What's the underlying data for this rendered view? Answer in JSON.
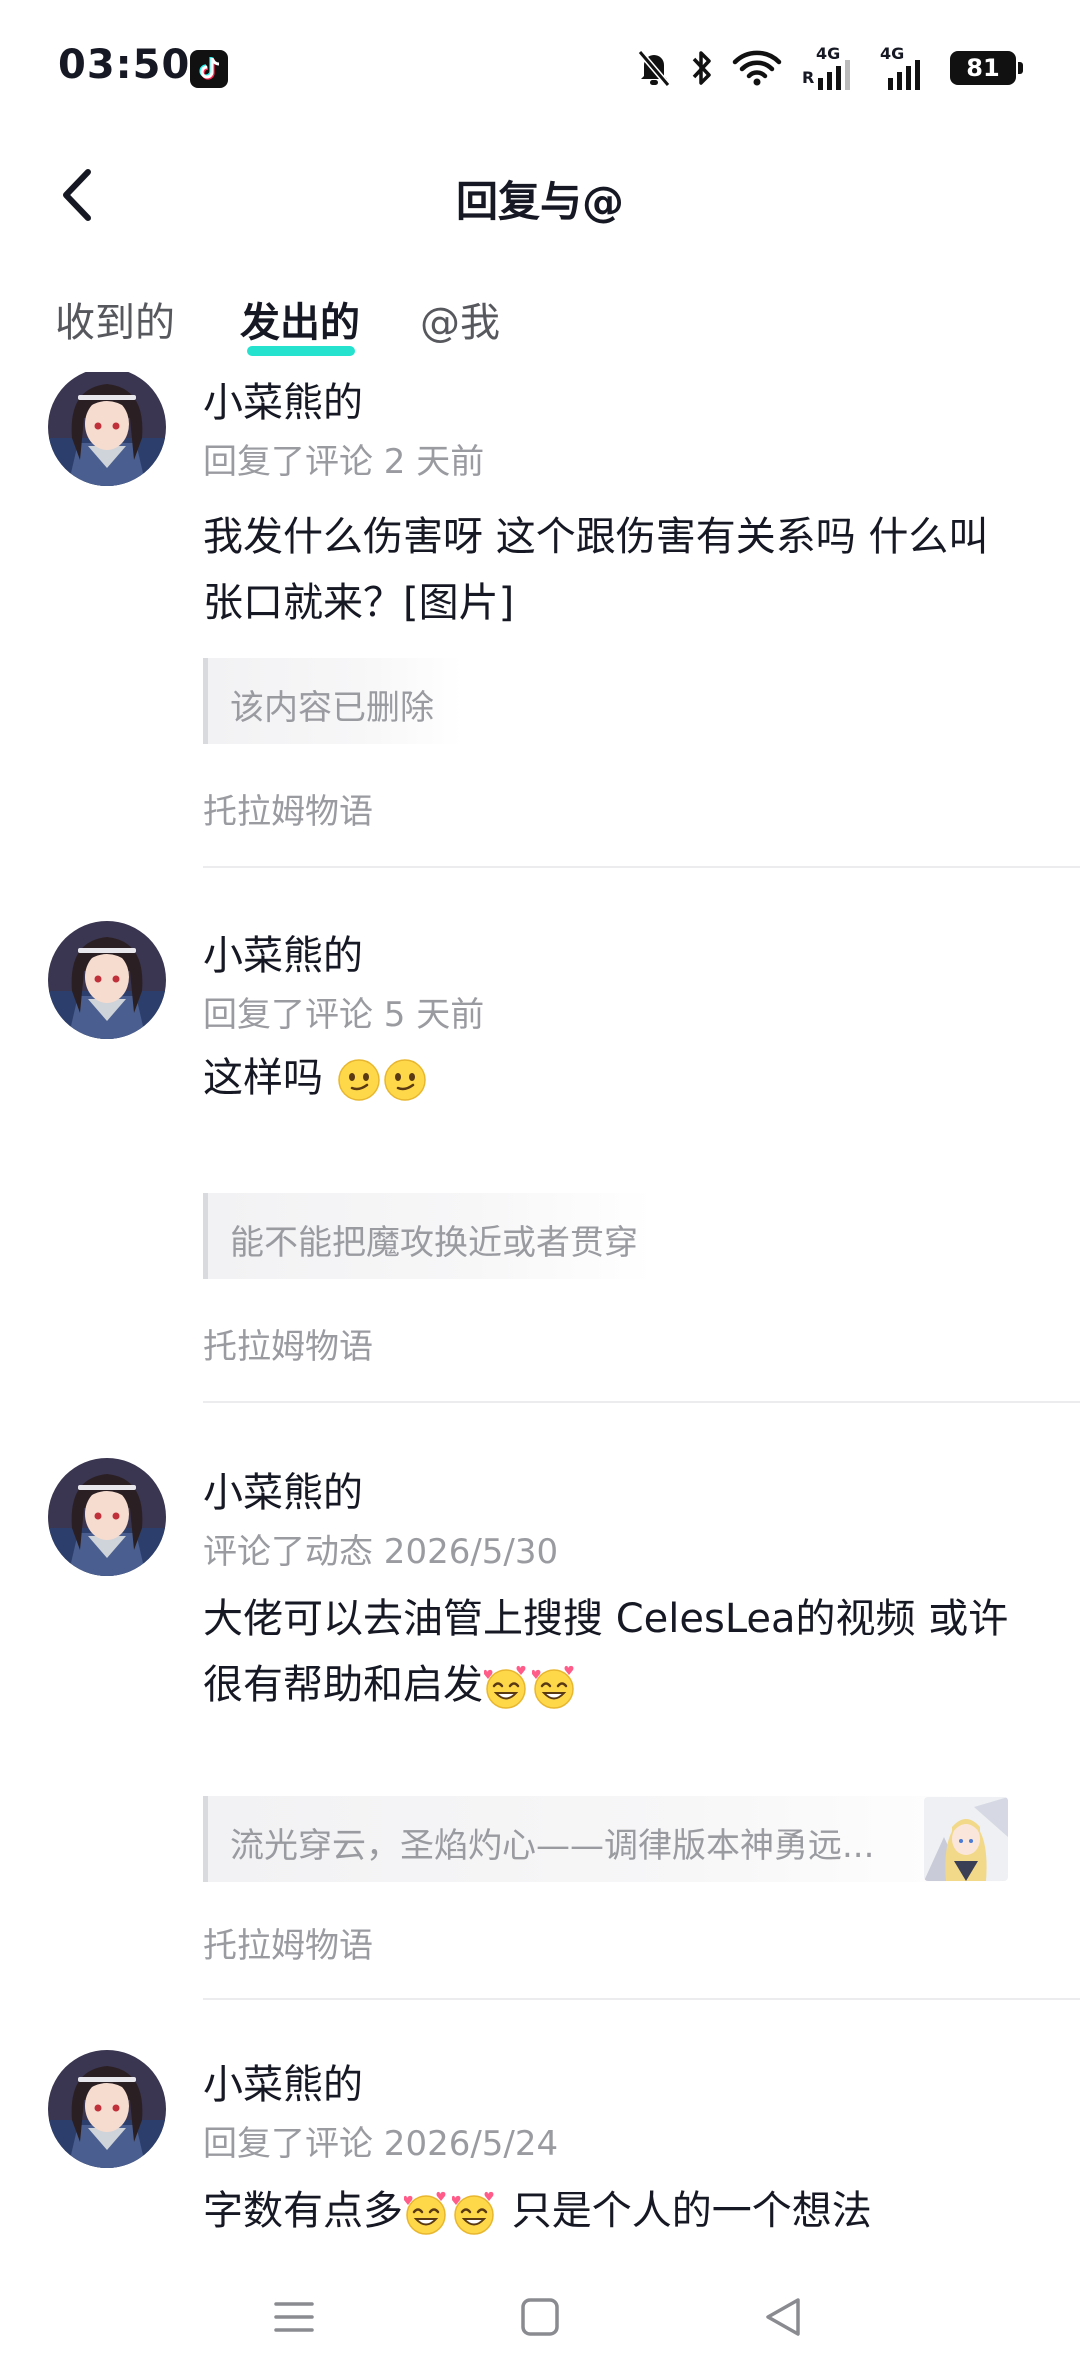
{
  "status_bar": {
    "time": "03:50",
    "app_icon": "tiktok-icon",
    "icons": [
      "bell-off-icon",
      "bluetooth-icon",
      "wifi-icon",
      "signal-4g-roaming-icon",
      "signal-4g-icon"
    ],
    "signal_labels": [
      "4G",
      "R",
      "4G"
    ],
    "battery": "81"
  },
  "header": {
    "title": "回复与@",
    "back_icon": "chevron-left-icon"
  },
  "tabs": [
    {
      "label": "收到的",
      "active": false
    },
    {
      "label": "发出的",
      "active": true
    },
    {
      "label": "@我",
      "active": false
    }
  ],
  "accent_color": "#25e2cf",
  "feed": {
    "items": [
      {
        "name": "小菜熊的",
        "meta": "回复了评论 2 天前",
        "content": "我发什么伤害呀 这个跟伤害有关系吗 什么叫张口就来？[图片]",
        "quote": "该内容已删除",
        "source": "托拉姆物语"
      },
      {
        "name": "小菜熊的",
        "meta": "回复了评论 5 天前",
        "content": "这样吗",
        "quote": "能不能把魔攻换近或者贯穿",
        "source": "托拉姆物语"
      },
      {
        "name": "小菜熊的",
        "meta": "评论了动态 2026/5/30",
        "content": "大佬可以去油管上搜搜 CelesLea的视频 或许很有帮助和启发",
        "quote": "流光穿云，圣焰灼心——调律版本神勇远...",
        "source": "托拉姆物语"
      },
      {
        "name": "小菜熊的",
        "meta": "回复了评论 2026/5/24",
        "content_a": "字数有点多",
        "content_b": " 只是个人的一个想法"
      }
    ]
  },
  "nav_bar": {
    "icons": [
      "menu-icon",
      "home-square-icon",
      "back-triangle-icon"
    ]
  }
}
